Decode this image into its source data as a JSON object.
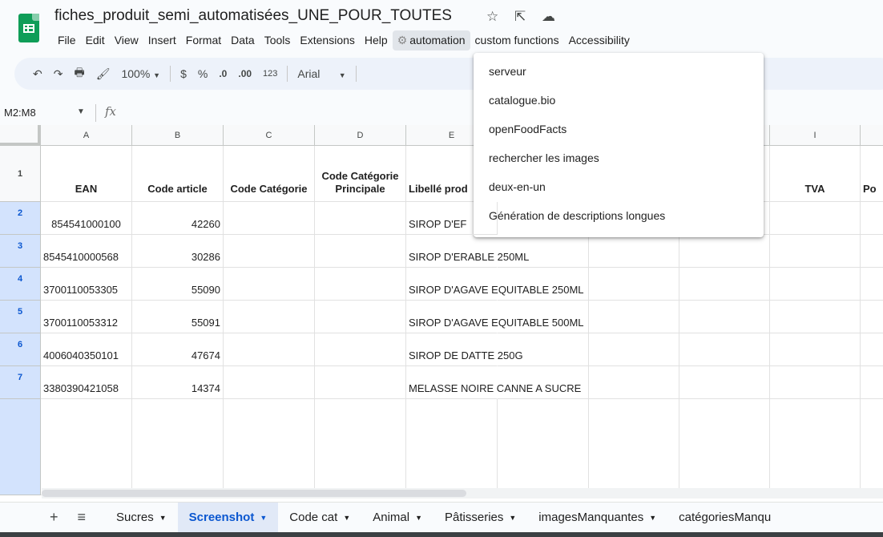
{
  "app": {
    "title": "fiches_produit_semi_automatisées_UNE_POUR_TOUTES",
    "icons": [
      "star-icon",
      "move-to-folder-icon",
      "cloud-status-icon"
    ]
  },
  "menu": {
    "items": [
      "File",
      "Edit",
      "View",
      "Insert",
      "Format",
      "Data",
      "Tools",
      "Extensions",
      "Help",
      "automation",
      "custom functions",
      "Accessibility"
    ],
    "active": "automation"
  },
  "toolbar": {
    "undo": "↶",
    "redo": "↷",
    "print": "🖶",
    "paint_format": "🖌",
    "zoom": "100%",
    "currency": "$",
    "percent": "%",
    "decrease_decimal": ".0",
    "increase_decimal": ".00",
    "number_format": "123",
    "font": "Arial"
  },
  "formula_bar": {
    "name_box": "M2:M8",
    "fx": "fx"
  },
  "columns": [
    "A",
    "B",
    "C",
    "D",
    "E",
    "I"
  ],
  "header_row": {
    "row_number": "1",
    "cells": [
      "EAN",
      "Code article",
      "Code Catégorie",
      "Code Catégorie Principale",
      "Libellé prod",
      "TVA",
      "Po"
    ]
  },
  "rows": [
    {
      "n": "2",
      "ean": "854541000100",
      "code": "42260",
      "libelle": "SIROP D'EF"
    },
    {
      "n": "3",
      "ean": "8545410000568",
      "code": "30286",
      "libelle": "SIROP D'ERABLE 250ML"
    },
    {
      "n": "4",
      "ean": "3700110053305",
      "code": "55090",
      "libelle": "SIROP D'AGAVE EQUITABLE 250ML"
    },
    {
      "n": "5",
      "ean": "3700110053312",
      "code": "55091",
      "libelle": "SIROP D'AGAVE EQUITABLE 500ML"
    },
    {
      "n": "6",
      "ean": "4006040350101",
      "code": "47674",
      "libelle": "SIROP DE DATTE 250G"
    },
    {
      "n": "7",
      "ean": "3380390421058",
      "code": "14374",
      "libelle": "MELASSE NOIRE CANNE A SUCRE"
    }
  ],
  "automation_menu": {
    "items": [
      "serveur",
      "catalogue.bio",
      "openFoodFacts",
      "rechercher les images",
      "deux-en-un",
      "Génération de descriptions longues"
    ]
  },
  "sheet_tabs": {
    "add": "+",
    "all_sheets": "≡",
    "tabs": [
      "Sucres",
      "Screenshot",
      "Code cat",
      "Animal",
      "Pâtisseries",
      "imagesManquantes",
      "catégoriesManqu"
    ],
    "active": "Screenshot"
  },
  "colors": {
    "brand_green": "#0f9d58",
    "selection_blue": "#0b57d0",
    "active_tab_bg": "#e1e9f7",
    "menu_active_bg": "#e1e5ea"
  }
}
